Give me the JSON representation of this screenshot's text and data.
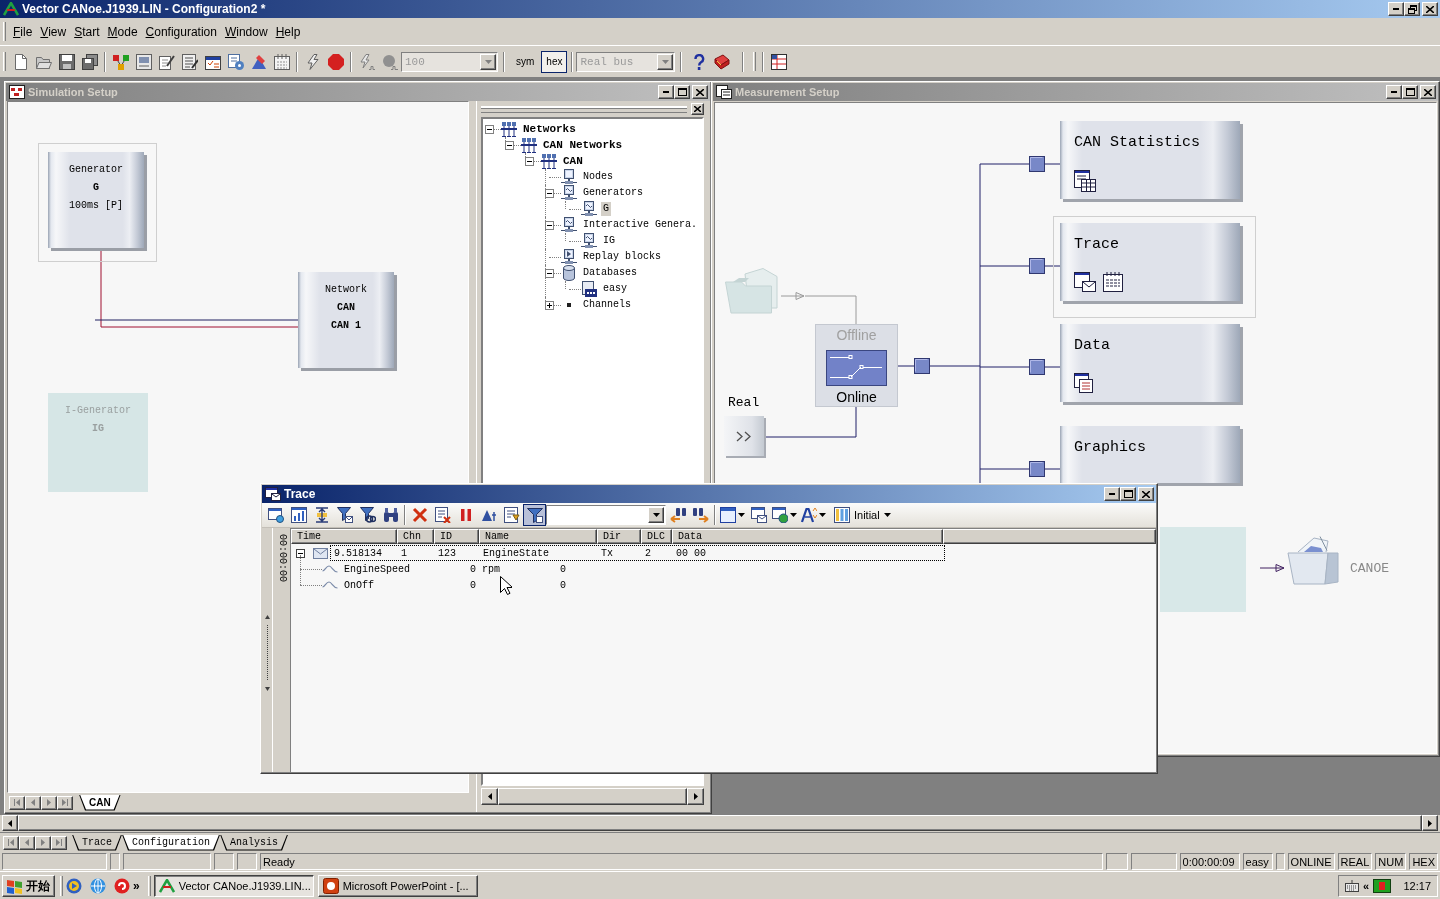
{
  "window": {
    "title": "Vector CANoe.J1939.LIN - Configuration2 *",
    "active": true
  },
  "menu": [
    "File",
    "View",
    "Start",
    "Mode",
    "Configuration",
    "Window",
    "Help"
  ],
  "toolbar": {
    "speed_combo": {
      "value": "100",
      "disabled": true
    },
    "format_buttons": [
      {
        "label": "sym",
        "selected": false
      },
      {
        "label": "hex",
        "selected": true
      }
    ],
    "bus_combo": {
      "value": "Real bus",
      "disabled": true
    }
  },
  "simulation_setup": {
    "title": "Simulation Setup",
    "active": false,
    "blocks": [
      {
        "kind": "generator",
        "type": "Generator",
        "name": "G",
        "detail": "100ms [P]",
        "selected": true,
        "disabled": false
      },
      {
        "kind": "network",
        "type": "Network",
        "name": "CAN",
        "detail": "CAN 1",
        "selected": false,
        "disabled": false
      },
      {
        "kind": "generator",
        "type": "I-Generator",
        "name": "IG",
        "selected": false,
        "disabled": true
      }
    ],
    "tree": [
      {
        "label": "Networks",
        "kind": "network",
        "expanded": true,
        "selected": false,
        "children": [
          {
            "label": "CAN Networks",
            "kind": "network",
            "expanded": true,
            "selected": false,
            "children": [
              {
                "label": "CAN",
                "kind": "network",
                "expanded": true,
                "selected": false,
                "children": [
                  {
                    "label": "Nodes",
                    "kind": "node",
                    "selected": false
                  },
                  {
                    "label": "Generators",
                    "kind": "generator",
                    "expanded": true,
                    "selected": false,
                    "children": [
                      {
                        "label": "G",
                        "kind": "generator",
                        "selected": true
                      }
                    ]
                  },
                  {
                    "label": "Interactive Genera.",
                    "kind": "generator",
                    "expanded": true,
                    "selected": false,
                    "children": [
                      {
                        "label": "IG",
                        "kind": "generator",
                        "selected": false
                      }
                    ]
                  },
                  {
                    "label": "Replay blocks",
                    "kind": "replay",
                    "selected": false
                  },
                  {
                    "label": "Databases",
                    "kind": "database",
                    "expanded": true,
                    "selected": false,
                    "children": [
                      {
                        "label": "easy",
                        "kind": "dbc",
                        "selected": false
                      }
                    ]
                  },
                  {
                    "label": "Channels",
                    "kind": "channel",
                    "expanded": false,
                    "selected": false
                  }
                ]
              }
            ]
          }
        ]
      }
    ],
    "tabs": [
      {
        "label": "CAN",
        "selected": true
      }
    ]
  },
  "measurement_setup": {
    "title": "Measurement Setup",
    "active": false,
    "real_label": "Real",
    "switch": [
      {
        "label": "Offline",
        "selected": false
      },
      {
        "label": "Online",
        "selected": true
      }
    ],
    "blocks": [
      {
        "kind": "statistics",
        "title": "CAN Statistics",
        "selected": false
      },
      {
        "kind": "trace",
        "title": "Trace",
        "selected": true
      },
      {
        "kind": "data",
        "title": "Data",
        "selected": false
      },
      {
        "kind": "graphics",
        "title": "Graphics",
        "selected": false
      }
    ],
    "logging_label": "CANOE"
  },
  "trace": {
    "title": "Trace",
    "active": true,
    "filter_on": true,
    "layout_button": "Initial",
    "time_bar": "00:00:00",
    "columns": [
      "Time",
      "Chn",
      "ID",
      "Name",
      "Dir",
      "DLC",
      "Data"
    ],
    "rows": [
      {
        "time": "9.518134",
        "chn": "1",
        "id": "123",
        "name": "EngineState",
        "dir": "Tx",
        "dlc": "2",
        "data": "00 00",
        "expanded": true,
        "selected": true,
        "signals": [
          {
            "name": "EngineSpeed",
            "value": "0 rpm",
            "raw": "0"
          },
          {
            "name": "OnOff",
            "value": "0",
            "raw": "0"
          }
        ]
      }
    ]
  },
  "workspace_tabs": [
    {
      "label": "Trace",
      "selected": false
    },
    {
      "label": "Configuration",
      "selected": true
    },
    {
      "label": "Analysis",
      "selected": false
    }
  ],
  "status_bar": {
    "message": "Ready",
    "elapsed": "0:00:00:09",
    "database": "easy",
    "indicators": [
      "ONLINE",
      "REAL",
      "NUM",
      "HEX"
    ]
  },
  "taskbar": {
    "start": "开始",
    "more": "»",
    "tasks": [
      {
        "label": "Vector CANoe.J1939.LIN...",
        "selected": true
      },
      {
        "label": "Microsoft PowerPoint - [...",
        "selected": false
      }
    ],
    "tray_toggle": "«",
    "clock": "12:17"
  }
}
